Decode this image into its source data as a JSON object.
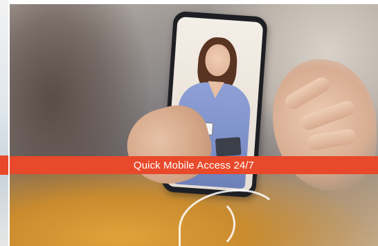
{
  "banner": {
    "caption": "Quick Mobile Access 24/7",
    "caption_bg_color": "#e8492a",
    "caption_text_color": "#ffffff"
  },
  "image": {
    "subject_icon": "telehealth-video-call-photo"
  }
}
